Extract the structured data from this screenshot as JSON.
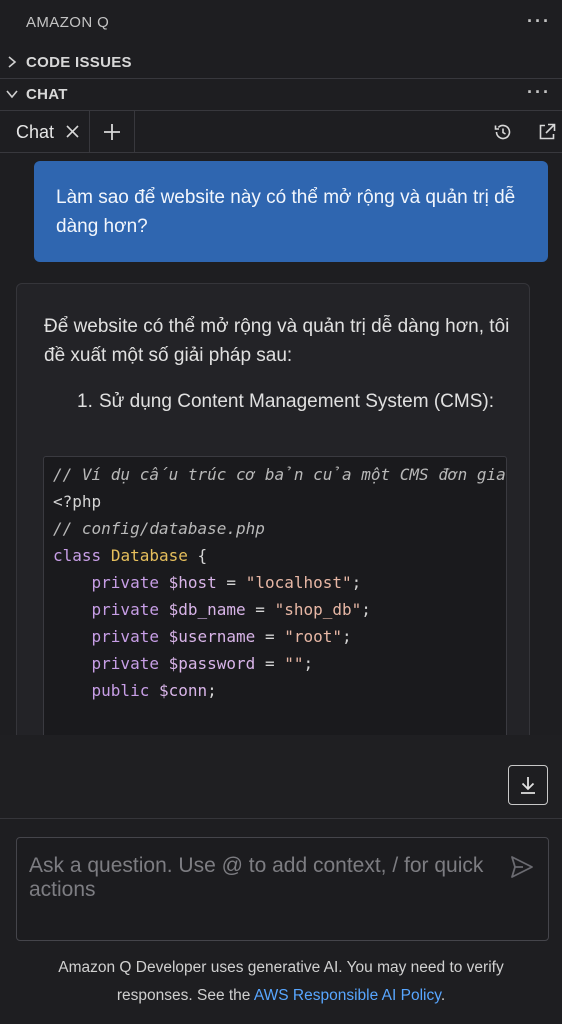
{
  "panel": {
    "title": "AMAZON Q",
    "more": "···"
  },
  "sections": {
    "code_issues": "CODE ISSUES",
    "chat": "CHAT",
    "chat_more": "···"
  },
  "tabs": {
    "active_label": "Chat"
  },
  "conversation": {
    "user_message": "Làm sao để website này có thể mở rộng và quản trị dễ dàng hơn?",
    "bot_intro": "Để website có thể mở rộng và quản trị dễ dàng hơn, tôi đề xuất một số giải pháp sau:",
    "list_number": "1.",
    "list_text": "Sử dụng Content Management System (CMS):",
    "code": {
      "l1": "// Ví dụ cấu trúc cơ bản của một CMS đơn giản",
      "l2": "<?php",
      "l3": "// config/database.php",
      "l4_kw": "class",
      "l4_cls": "Database",
      "l4_brace": " {",
      "l5_kw": "private",
      "l5_var": "$host",
      "l5_eq": " = ",
      "l5_str": "\"localhost\"",
      "l5_end": ";",
      "l6_kw": "private",
      "l6_var": "$db_name",
      "l6_eq": " = ",
      "l6_str": "\"shop_db\"",
      "l6_end": ";",
      "l7_kw": "private",
      "l7_var": "$username",
      "l7_eq": " = ",
      "l7_str": "\"root\"",
      "l7_end": ";",
      "l8_kw": "private",
      "l8_var": "$password",
      "l8_eq": " = ",
      "l8_str": "\"\"",
      "l8_end": ";",
      "l9_kw": "public",
      "l9_var": "$conn",
      "l9_end": ";"
    }
  },
  "input": {
    "placeholder": "Ask a question. Use @ to add context, / for quick actions"
  },
  "footer": {
    "text_before": "Amazon Q Developer uses generative AI. You may need to verify responses. See the ",
    "link": "AWS Responsible AI Policy",
    "text_after": "."
  },
  "colors": {
    "background": "#1e1e21",
    "user_bubble": "#2f66b0",
    "link": "#58a6ff"
  },
  "icons": [
    "chevron-right-icon",
    "chevron-down-icon",
    "close-icon",
    "plus-icon",
    "history-icon",
    "external-link-icon",
    "scroll-down-icon",
    "send-icon"
  ]
}
